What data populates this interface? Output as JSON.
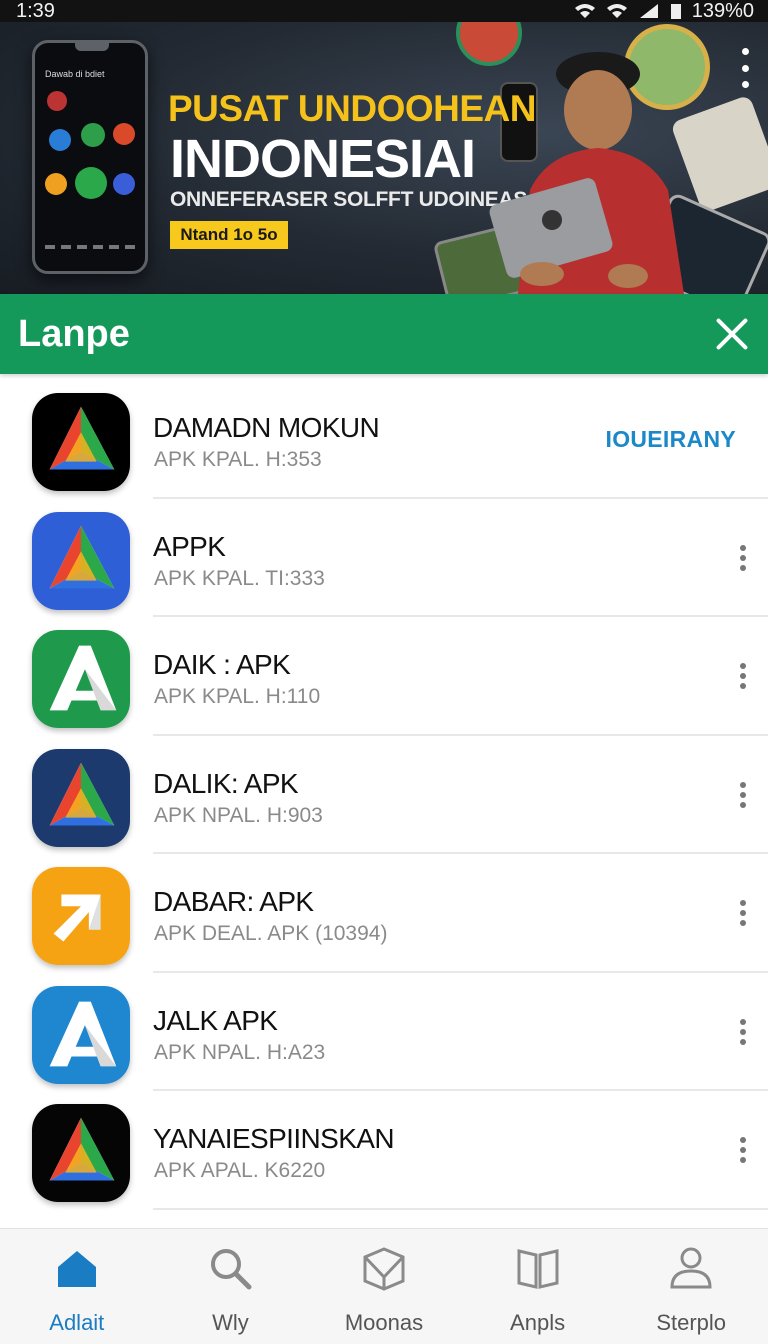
{
  "status_bar": {
    "time": "1:39",
    "battery": "139%0",
    "icons": [
      "wifi-icon",
      "wifi-icon",
      "signal-icon",
      "battery-icon"
    ]
  },
  "banner": {
    "phone_screen_title": "Dawab di bdiet",
    "line1": "PUSAT UNDOOHEAN",
    "line2": "INDONESIAI",
    "line3": "ONNEFERASER SOLFFT UDOINEAS",
    "pill": "Ntand 1o 5o",
    "menu_icon": "more-vertical-icon"
  },
  "app_bar": {
    "brand": "Lanpe",
    "close_icon": "close-icon"
  },
  "apps": [
    {
      "title": "DAMADN MOKUN",
      "subtitle": "APK KPAL. H:353",
      "action": "IOUEIRANY",
      "icon_name": "prism-app-icon",
      "icon_bg": "#000000"
    },
    {
      "title": "APPK",
      "subtitle": "APK KPAL. TI:333",
      "action": "",
      "icon_name": "prism-app-icon",
      "icon_bg": "#2f5fd6"
    },
    {
      "title": "DAIK : APK",
      "subtitle": "APK KPAL. H:110",
      "action": "",
      "icon_name": "letter-a-icon",
      "icon_bg": "#1f9a4c"
    },
    {
      "title": "DALIK: APK",
      "subtitle": "APK NPAL. H:903",
      "action": "",
      "icon_name": "prism-app-icon",
      "icon_bg": "#1c3a6e"
    },
    {
      "title": "DABAR: APK",
      "subtitle": "APK DEAL. APK (10394)",
      "action": "",
      "icon_name": "arrow-app-icon",
      "icon_bg": "#f5a312"
    },
    {
      "title": "JALK APK",
      "subtitle": "APK NPAL. H:A23",
      "action": "",
      "icon_name": "letter-a-icon",
      "icon_bg": "#1f86d0"
    },
    {
      "title": "YANAIESPIINSKAN",
      "subtitle": "APK APAL. K6220",
      "action": "",
      "icon_name": "prism-app-icon",
      "icon_bg": "#050505"
    }
  ],
  "bottom_nav": [
    {
      "label": "Adlait",
      "icon": "home-icon",
      "active": true
    },
    {
      "label": "Wly",
      "icon": "search-icon",
      "active": false
    },
    {
      "label": "Moonas",
      "icon": "box-icon",
      "active": false
    },
    {
      "label": "Anpls",
      "icon": "book-icon",
      "active": false
    },
    {
      "label": "Sterplo",
      "icon": "person-icon",
      "active": false
    }
  ],
  "colors": {
    "accent_green": "#14995b",
    "accent_blue": "#1b88c8",
    "headline_yellow": "#f4c21b"
  }
}
